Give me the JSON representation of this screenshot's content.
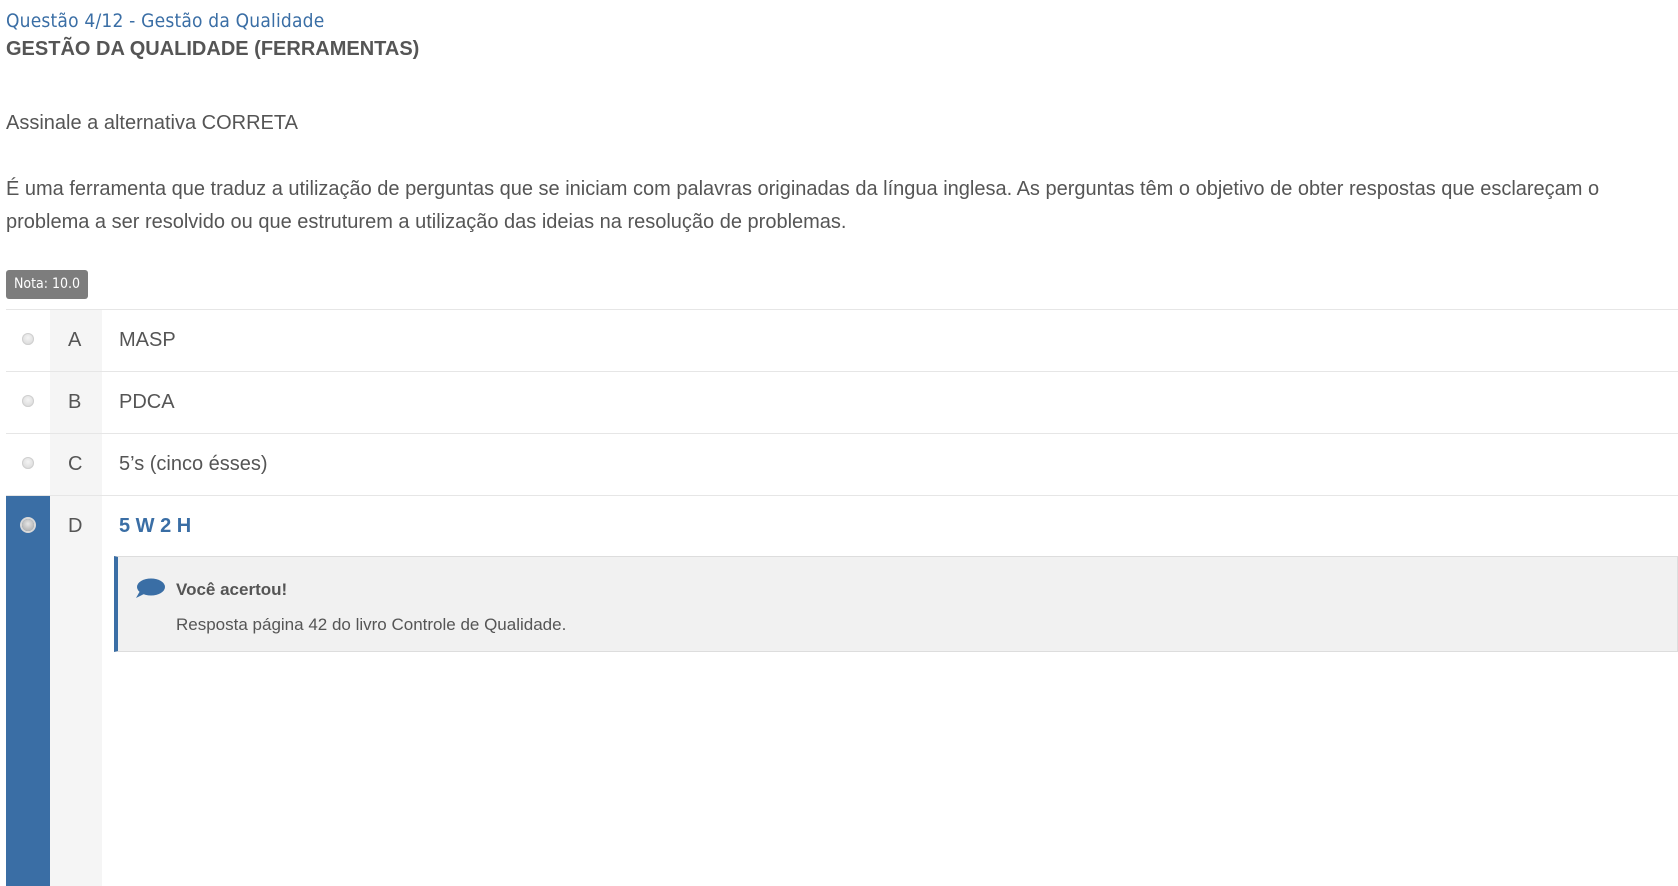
{
  "question": {
    "title": "Questão 4/12 - Gestão da Qualidade",
    "subject": "GESTÃO DA QUALIDADE (FERRAMENTAS)",
    "instruction": "Assinale a alternativa CORRETA",
    "statement": "É uma ferramenta que traduz a utilização de perguntas que se iniciam com palavras originadas da língua inglesa. As perguntas têm o objetivo de obter respostas que esclareçam o problema a ser resolvido ou que estruturem a utilização das ideias na resolução de problemas."
  },
  "grade": {
    "label": "Nota: 10.0"
  },
  "alternatives": [
    {
      "letter": "A",
      "text": "MASP",
      "selected": false
    },
    {
      "letter": "B",
      "text": "PDCA",
      "selected": false
    },
    {
      "letter": "C",
      "text": "5’s (cinco ésses)",
      "selected": false
    },
    {
      "letter": "D",
      "text": "5 W 2 H",
      "selected": true
    }
  ],
  "feedback": {
    "icon": "speech-bubble-icon",
    "title": "Você acertou!",
    "text": "Resposta página 42 do livro Controle de Qualidade."
  },
  "colors": {
    "accent": "#3a6ea5",
    "text": "#555555",
    "badge": "#7d7d7d",
    "feedback_bg": "#f1f1f1"
  }
}
